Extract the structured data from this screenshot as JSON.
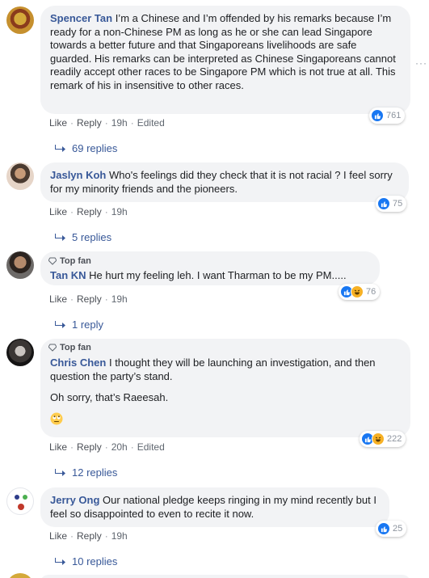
{
  "actions": {
    "like": "Like",
    "reply": "Reply",
    "edited": "Edited",
    "sep": "·"
  },
  "top_fan_label": "Top fan",
  "colors": {
    "link": "#385898",
    "bubble": "#f2f3f5",
    "like_blue": "#1877f2",
    "haha_yellow": "#f7b125"
  },
  "comments": [
    {
      "author": "Spencer Tan",
      "text": "I’m a Chinese and I’m offended by his remarks because I’m ready for a non-Chinese PM as long as he or she can lead Singapore towards a better future and that Singaporeans livelihoods are safe guarded. His remarks can be interpreted as Chinese Singaporeans cannot readily accept other races to be Singapore PM which is not true at all. This remark of his in insensitive to other races.",
      "time": "19h",
      "edited": true,
      "reactions": [
        "like"
      ],
      "reaction_count": "761",
      "replies": "69 replies"
    },
    {
      "author": "Jaslyn Koh",
      "text": "Who's feelings did they check that it is not racial ? I feel sorry for my minority friends and the pioneers.",
      "time": "19h",
      "edited": false,
      "reactions": [
        "like"
      ],
      "reaction_count": "75",
      "replies": "5 replies"
    },
    {
      "top_fan": true,
      "author": "Tan KN",
      "text": "He hurt my feeling leh. I want Tharman to be my PM.....",
      "time": "19h",
      "edited": false,
      "reactions": [
        "like",
        "haha"
      ],
      "reaction_count": "76",
      "replies": "1 reply"
    },
    {
      "top_fan": true,
      "author": "Chris Chen",
      "text": "I thought they will be launching an investigation, and then question the party’s stand.",
      "text2": "Oh sorry, that’s Raeesah.",
      "emoji": "rolling-eyes-emoji",
      "time": "20h",
      "edited": true,
      "reactions": [
        "like",
        "haha"
      ],
      "reaction_count": "222",
      "replies": "12 replies"
    },
    {
      "author": "Jerry Ong",
      "text": "Our national pledge keeps ringing in my mind recently but I feel so disappointed to even to recite it now.",
      "time": "19h",
      "edited": false,
      "reactions": [
        "like"
      ],
      "reaction_count": "25",
      "replies": "10 replies"
    }
  ]
}
